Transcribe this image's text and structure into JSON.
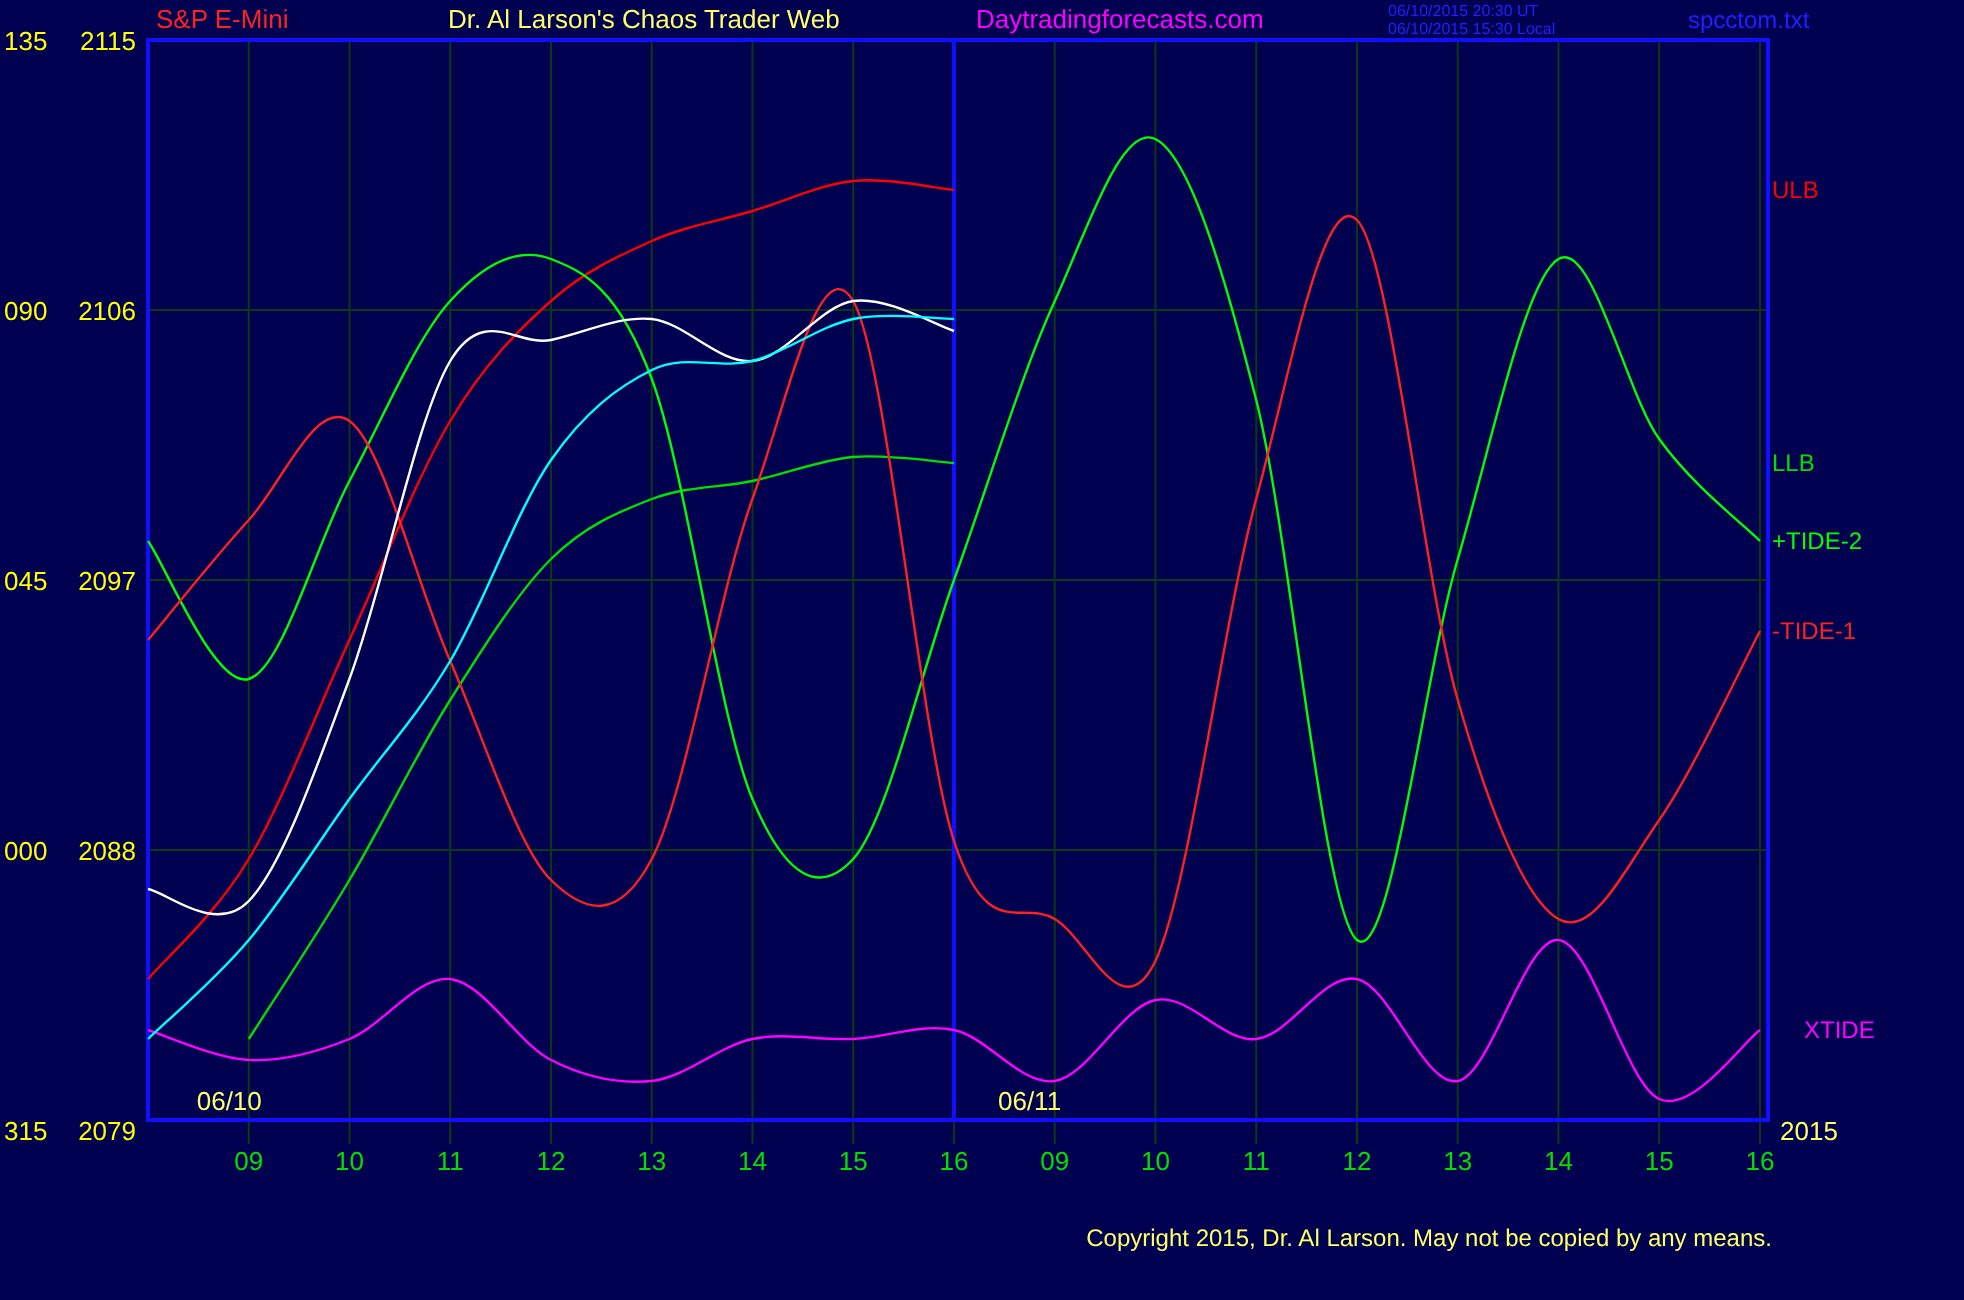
{
  "header": {
    "instrument": "S&P E-Mini",
    "title": "Dr. Al Larson's Chaos Trader Web",
    "site": "Daytradingforecasts.com",
    "timestamps": [
      "06/10/2015 20:30 UT",
      "06/10/2015 15:30 Local"
    ],
    "file": "spcctom.txt"
  },
  "chart": {
    "chart_data": {
      "type": "line",
      "ylim": [
        2079,
        2115
      ],
      "categories": [
        null,
        "09",
        "10",
        "11",
        "12",
        "13",
        "14",
        "15",
        "16",
        "09",
        "10",
        "11",
        "12",
        "13",
        "14",
        "15",
        "16"
      ],
      "yticks": [
        2115,
        2106,
        2097,
        2088,
        2079
      ],
      "grid": true,
      "series": [
        {
          "name": "ULB",
          "color": "#ff0000",
          "values": [
            2083.7,
            2087.7,
            2095.0,
            2102.3,
            2106.3,
            2108.3,
            2109.3,
            2110.3,
            2110.0,
            null,
            null,
            null,
            null,
            null,
            null,
            null,
            null
          ]
        },
        {
          "name": "LLB",
          "color": "#00e000",
          "values": [
            null,
            2081.7,
            2087.0,
            2093.0,
            2097.7,
            2099.7,
            2100.3,
            2101.1,
            2100.9,
            null,
            null,
            null,
            null,
            null,
            null,
            null,
            null
          ]
        },
        {
          "name": "+TIDE-2",
          "color": "#00ff00",
          "values": [
            2098.3,
            2093.7,
            2100.3,
            2106.3,
            2107.7,
            2103.7,
            2089.7,
            2087.7,
            2097.0,
            2106.3,
            2111.7,
            2103.0,
            2085.0,
            2097.7,
            2107.7,
            2101.7,
            2098.3
          ]
        },
        {
          "name": "-TIDE-1",
          "color": "#ff2020",
          "values": [
            2095.0,
            2099.0,
            2102.3,
            2094.3,
            2087.0,
            2087.7,
            2099.7,
            2106.3,
            2088.3,
            2085.7,
            2084.3,
            2099.7,
            2109.0,
            2093.0,
            2085.7,
            2089.0,
            2095.3
          ]
        },
        {
          "name": "XTIDE",
          "color": "#ff00ff",
          "values": [
            2082.0,
            2081.0,
            2081.7,
            2083.7,
            2081.0,
            2080.3,
            2081.7,
            2081.7,
            2082.0,
            2080.3,
            2083.0,
            2081.7,
            2083.7,
            2080.3,
            2085.0,
            2079.7,
            2082.0
          ]
        },
        {
          "color": "#ffffff",
          "values": [
            2086.7,
            2086.3,
            2093.7,
            2104.3,
            2105.0,
            2105.7,
            2104.3,
            2106.3,
            2105.3,
            null,
            null,
            null,
            null,
            null,
            null,
            null,
            null
          ]
        },
        {
          "color": "#00ffff",
          "values": [
            2081.7,
            2085.0,
            2089.7,
            2094.3,
            2101.0,
            2104.0,
            2104.3,
            2105.7,
            2105.7,
            null,
            null,
            null,
            null,
            null,
            null,
            null,
            null
          ]
        }
      ]
    },
    "angle_labels": [
      "135",
      "090",
      "045",
      "000",
      "315"
    ],
    "date_labels": [
      "06/10",
      "06/11"
    ],
    "year_label": "2015"
  },
  "copyright": "Copyright 2015, Dr. Al Larson. May not be copied by any means."
}
